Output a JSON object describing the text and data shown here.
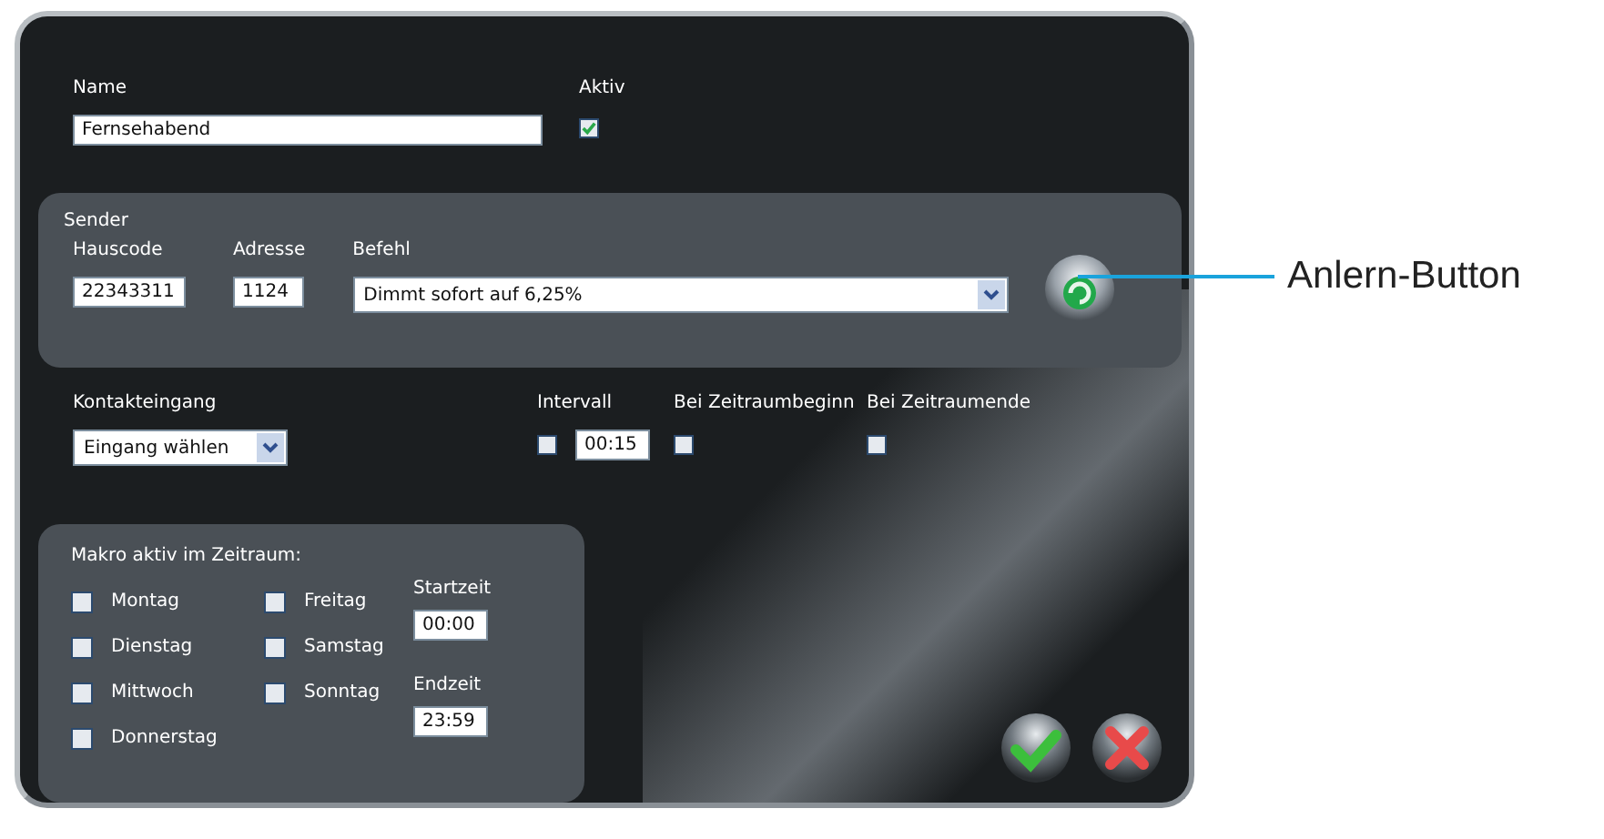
{
  "name": {
    "label": "Name",
    "value": "Fernsehabend"
  },
  "aktiv": {
    "label": "Aktiv",
    "checked": true
  },
  "sender": {
    "title": "Sender",
    "fields": [
      {
        "label": "Hauscode",
        "value": "22343311"
      },
      {
        "label": "Adresse",
        "value": "1124"
      }
    ],
    "befehl": {
      "label": "Befehl",
      "value": "Dimmt sofort auf 6,25%"
    }
  },
  "kontakteingang": {
    "label": "Kontakteingang",
    "value": "Eingang wählen"
  },
  "intervall": {
    "label": "Intervall",
    "checked": false,
    "value": "00:15"
  },
  "zeitraumbeginn": {
    "label": "Bei Zeitraumbeginn",
    "checked": false
  },
  "zeitraumende": {
    "label": "Bei Zeitraumende",
    "checked": false
  },
  "makro": {
    "title": "Makro aktiv im Zeitraum:",
    "days": [
      {
        "label": "Montag",
        "checked": false
      },
      {
        "label": "Dienstag",
        "checked": false
      },
      {
        "label": "Mittwoch",
        "checked": false
      },
      {
        "label": "Donnerstag",
        "checked": false
      },
      {
        "label": "Freitag",
        "checked": false
      },
      {
        "label": "Samstag",
        "checked": false
      },
      {
        "label": "Sonntag",
        "checked": false
      }
    ],
    "startzeit": {
      "label": "Startzeit",
      "value": "00:00"
    },
    "endzeit": {
      "label": "Endzeit",
      "value": "23:59"
    }
  },
  "callout": {
    "label": "Anlern-Button"
  }
}
